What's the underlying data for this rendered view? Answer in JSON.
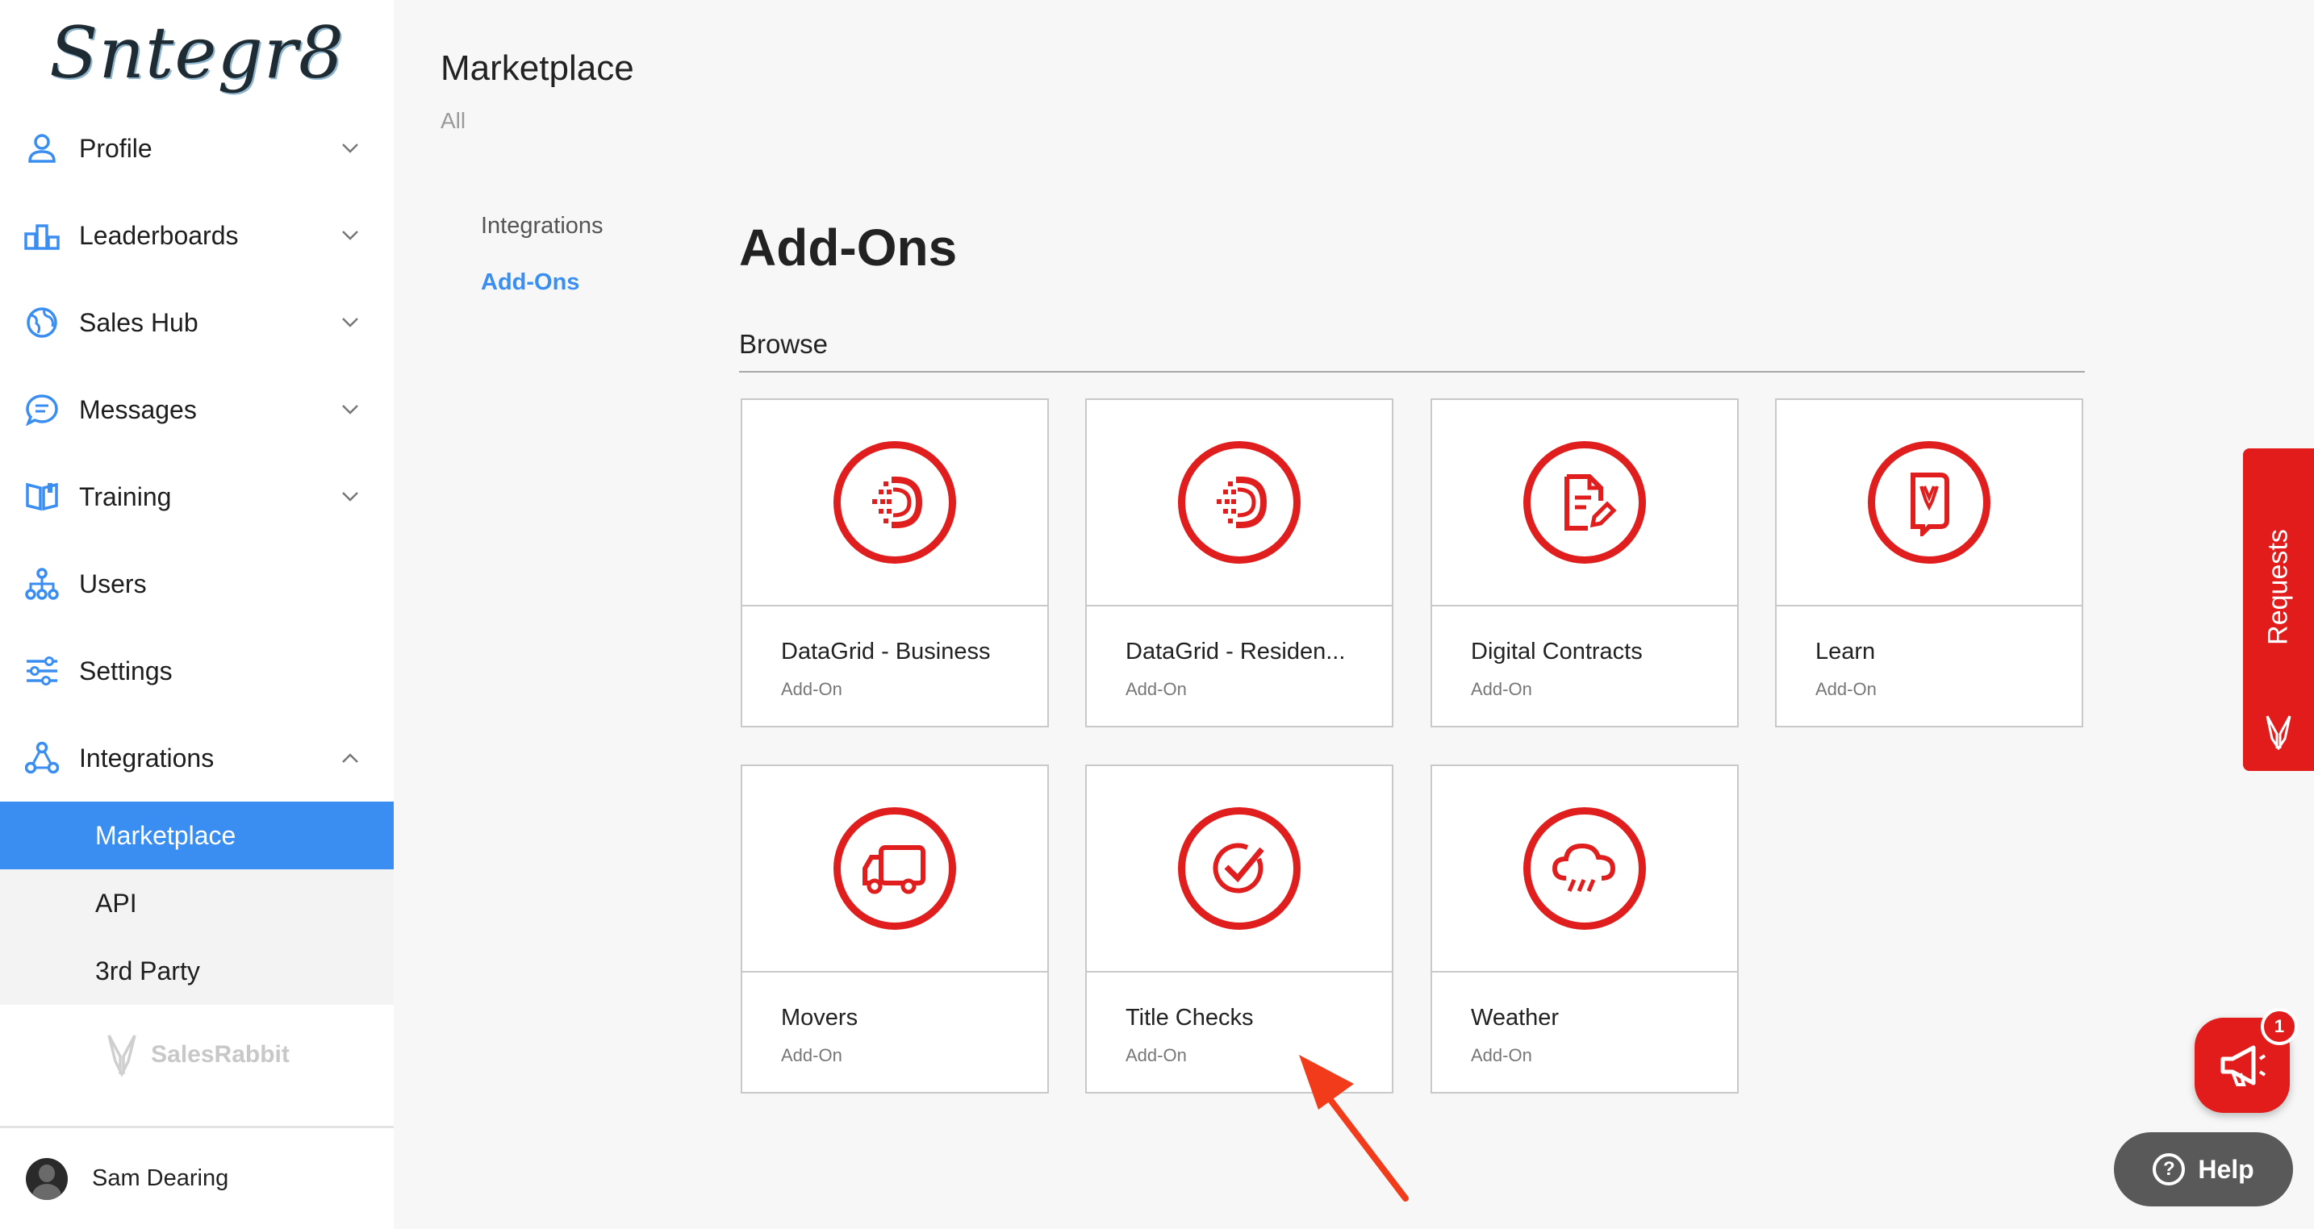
{
  "brand": {
    "logo_text": "Sntegr8",
    "footer_brand": "SalesRabbit"
  },
  "sidebar": {
    "items": [
      {
        "label": "Profile",
        "icon": "user-icon",
        "expandable": true
      },
      {
        "label": "Leaderboards",
        "icon": "podium-icon",
        "expandable": true
      },
      {
        "label": "Sales Hub",
        "icon": "globe-icon",
        "expandable": true
      },
      {
        "label": "Messages",
        "icon": "chat-icon",
        "expandable": true
      },
      {
        "label": "Training",
        "icon": "book-icon",
        "expandable": true
      },
      {
        "label": "Users",
        "icon": "org-chart-icon",
        "expandable": false
      },
      {
        "label": "Settings",
        "icon": "sliders-icon",
        "expandable": false
      },
      {
        "label": "Integrations",
        "icon": "network-icon",
        "expandable": true,
        "expanded": true
      }
    ],
    "integrations_sub": [
      {
        "label": "Marketplace",
        "active": true
      },
      {
        "label": "API",
        "active": false
      },
      {
        "label": "3rd Party",
        "active": false
      }
    ],
    "user": {
      "name": "Sam Dearing"
    }
  },
  "header": {
    "title": "Marketplace",
    "breadcrumb": "All"
  },
  "subnav": {
    "items": [
      {
        "label": "Integrations",
        "active": false
      },
      {
        "label": "Add-Ons",
        "active": true
      }
    ]
  },
  "main": {
    "section_title": "Add-Ons",
    "browse_label": "Browse",
    "cards": [
      {
        "name": "DataGrid - Business",
        "type": "Add-On",
        "icon": "datagrid-icon"
      },
      {
        "name": "DataGrid - Residen...",
        "type": "Add-On",
        "icon": "datagrid-icon"
      },
      {
        "name": "Digital Contracts",
        "type": "Add-On",
        "icon": "document-edit-icon"
      },
      {
        "name": "Learn",
        "type": "Add-On",
        "icon": "learn-book-icon"
      },
      {
        "name": "Movers",
        "type": "Add-On",
        "icon": "truck-icon"
      },
      {
        "name": "Title Checks",
        "type": "Add-On",
        "icon": "checkmark-icon"
      },
      {
        "name": "Weather",
        "type": "Add-On",
        "icon": "cloud-rain-icon"
      }
    ]
  },
  "widgets": {
    "requests_label": "Requests",
    "notification_count": "1",
    "help_label": "Help",
    "accent_color": "#e21b1b",
    "active_color": "#3a8ef2"
  }
}
